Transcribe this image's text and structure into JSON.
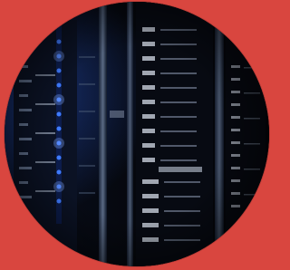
{
  "image": {
    "subject": "server-rack-photo",
    "shape": "circle",
    "background_color": "#d9463f",
    "dominant_colors": [
      "#05070c",
      "#0a1020",
      "#1e3a8a",
      "#2f6bff",
      "#cfd8e6"
    ],
    "accent_glow_color": "#2f6bff"
  }
}
